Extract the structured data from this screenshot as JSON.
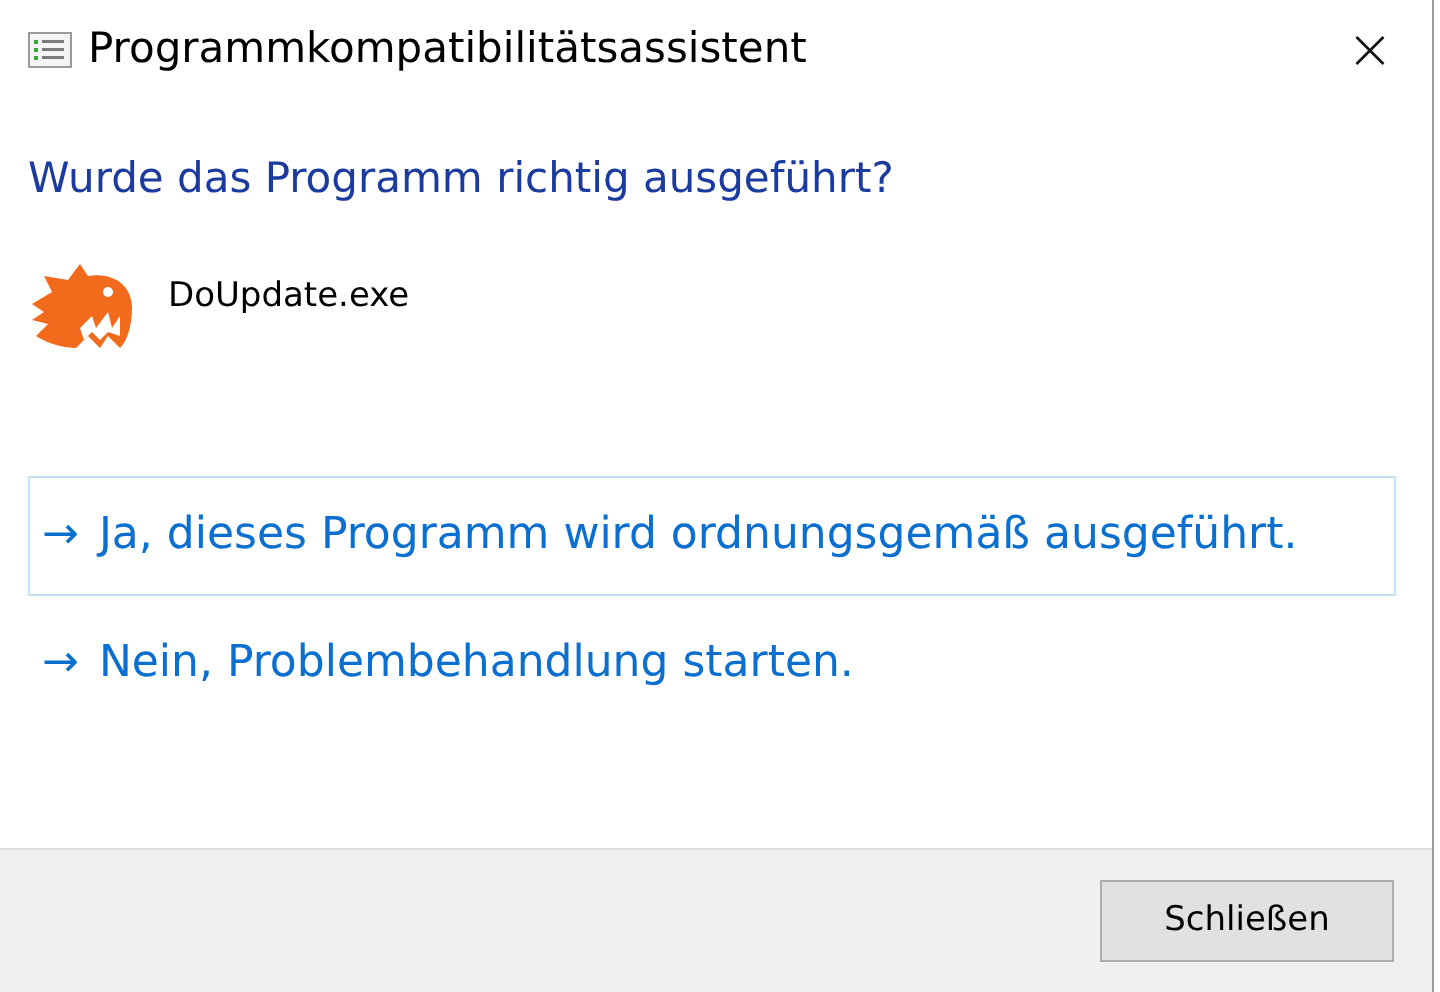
{
  "window": {
    "title": "Programmkompatibilitätsassistent",
    "close": "×"
  },
  "heading": "Wurde das Programm richtig ausgeführt?",
  "program": {
    "name": "DoUpdate.exe"
  },
  "commands": [
    {
      "arrow": "→",
      "label": "Ja, dieses Programm wird ordnungsgemäß ausgeführt.",
      "selected": true
    },
    {
      "arrow": "→",
      "label": "Nein, Problembehandlung starten.",
      "selected": false
    }
  ],
  "buttons": [
    "Schließen"
  ]
}
